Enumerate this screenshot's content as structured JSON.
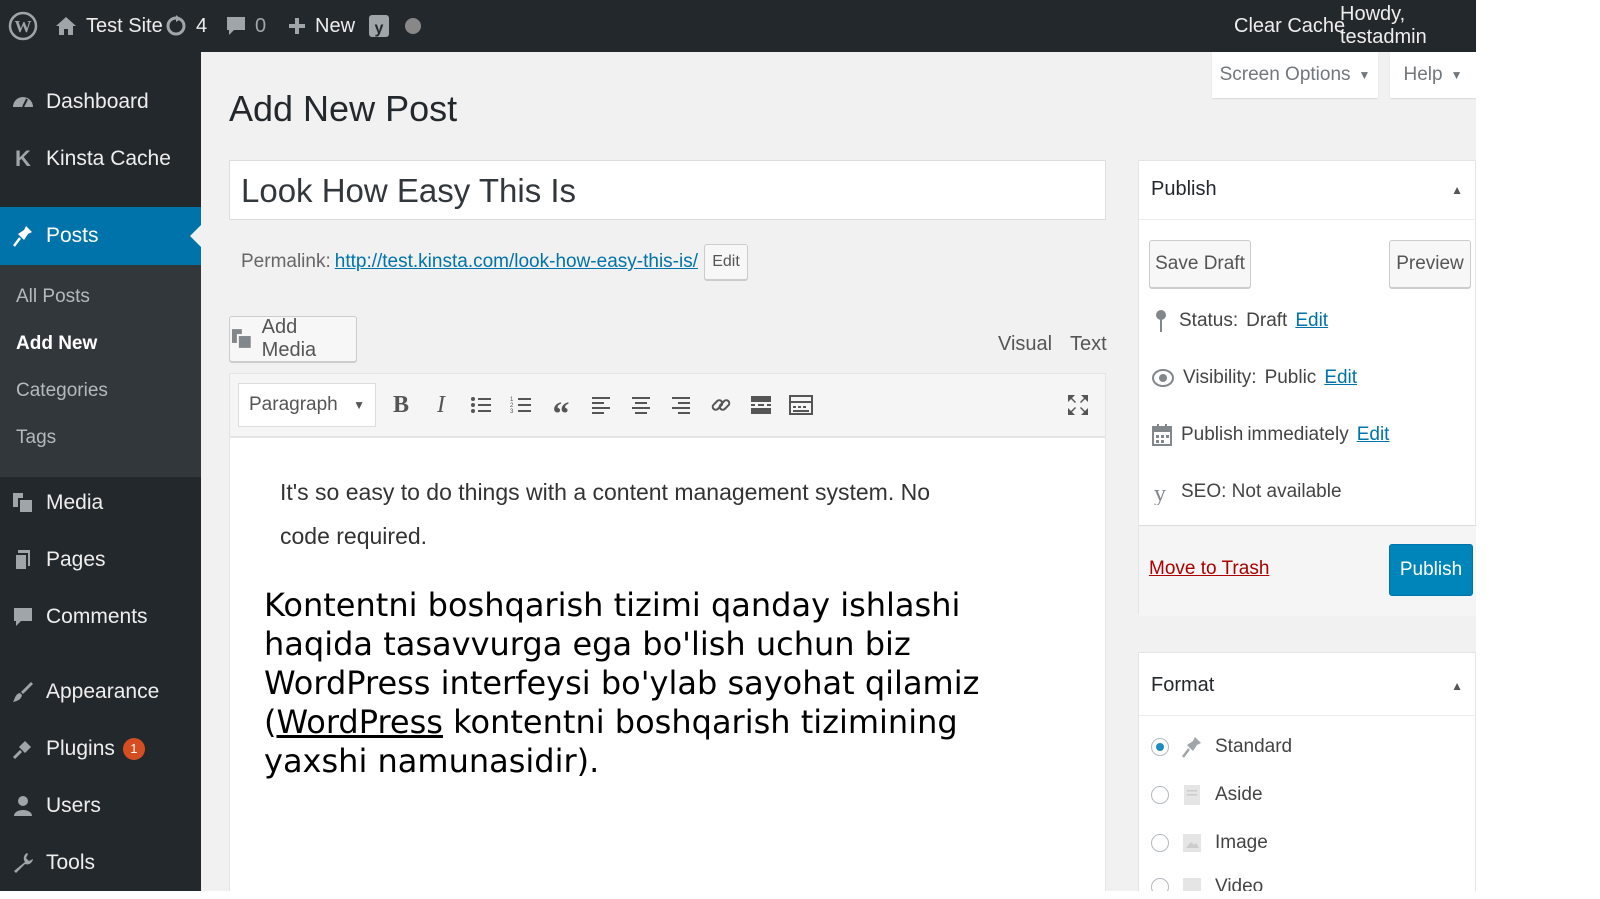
{
  "adminbar": {
    "site": "Test Site",
    "updates": "4",
    "comments": "0",
    "new": "New",
    "clear_cache": "Clear Cache",
    "howdy": "Howdy, testadmin"
  },
  "sidebar": {
    "dashboard": "Dashboard",
    "kinsta": "Kinsta Cache",
    "posts": "Posts",
    "sub": [
      "All Posts",
      "Add New",
      "Categories",
      "Tags"
    ],
    "media": "Media",
    "pages": "Pages",
    "comments": "Comments",
    "appearance": "Appearance",
    "plugins": "Plugins",
    "plugins_badge": "1",
    "users": "Users",
    "tools": "Tools"
  },
  "screen_options": "Screen Options",
  "help": "Help",
  "page_title": "Add New Post",
  "post_title": "Look How Easy This Is",
  "permalink": {
    "label": "Permalink:",
    "url": "http://test.kinsta.com/look-how-easy-this-is/",
    "edit": "Edit"
  },
  "add_media": "Add Media",
  "tabs": {
    "visual": "Visual",
    "text": "Text"
  },
  "format_select": "Paragraph",
  "editor": {
    "p1": "It's so easy to do things with a content management system. No code required.",
    "p2_before": "Kontentni boshqarish tizimi qanday ishlashi haqida tasavvurga ega bo'lish uchun biz WordPress interfeysi bo'ylab sayohat qilamiz (",
    "p2_link": "WordPress",
    "p2_after": " kontentni boshqarish tizimining yaxshi namunasidir)."
  },
  "publish": {
    "title": "Publish",
    "save_draft": "Save Draft",
    "preview": "Preview",
    "status_label": "Status:",
    "status_value": "Draft",
    "visibility_label": "Visibility:",
    "visibility_value": "Public",
    "schedule_label": "Publish",
    "schedule_value": "immediately",
    "edit": "Edit",
    "seo": "SEO: Not available",
    "trash": "Move to Trash",
    "publish_btn": "Publish"
  },
  "format": {
    "title": "Format",
    "options": [
      "Standard",
      "Aside",
      "Image",
      "Video"
    ]
  },
  "colors": {
    "accent": "#0073aa",
    "adminbar": "#23282d",
    "trash": "#a00"
  }
}
